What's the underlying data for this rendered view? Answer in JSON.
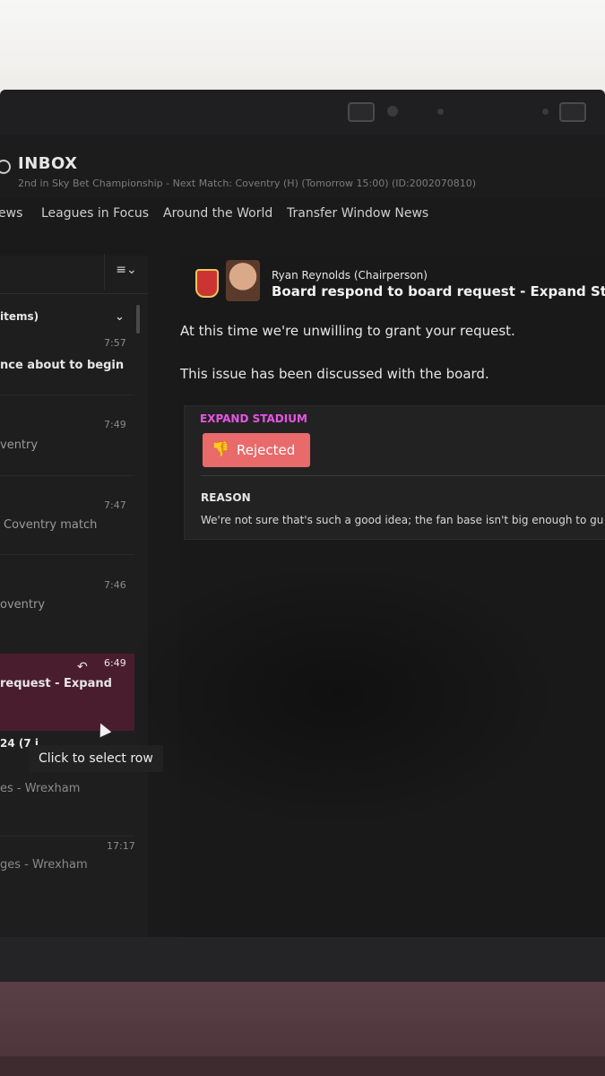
{
  "header": {
    "title": "INBOX",
    "subtitle": "2nd in Sky Bet Championship - Next Match: Coventry (H) (Tomorrow 15:00) (ID:2002070810)"
  },
  "tabs": [
    "ews",
    "Leagues in Focus",
    "Around the World",
    "Transfer Window News"
  ],
  "sidebar": {
    "sort_icon": "≡⌄",
    "group_header": "items)",
    "group_chevron": "⌄",
    "messages": [
      {
        "time": "7:57",
        "subject": "nce about to begin",
        "text": ""
      },
      {
        "time": "7:49",
        "subject": "",
        "text": "ventry"
      },
      {
        "time": "7:47",
        "subject": "",
        "text": "Coventry match"
      },
      {
        "time": "7:46",
        "subject": "",
        "text": "oventry"
      },
      {
        "time": "6:49",
        "subject": "request - Expand",
        "text": ""
      }
    ],
    "group2_header": "24 (7 i",
    "tooltip": "Click to select row",
    "later": [
      {
        "time": "",
        "text": "es - Wrexham"
      },
      {
        "time": "17:17",
        "text": "ges - Wrexham"
      }
    ]
  },
  "detail": {
    "sender_name": "Ryan Reynolds",
    "sender_role": "(Chairperson)",
    "subject": "Board respond to board request - Expand Stadiu",
    "body": [
      "At this time we're unwilling to grant your request.",
      "This issue has been discussed with the board."
    ],
    "card": {
      "title": "EXPAND STADIUM",
      "status": "Rejected",
      "reason_title": "REASON",
      "reason_text": "We're not sure that's such a good idea; the fan base isn't big enough to gu"
    }
  },
  "colors": {
    "accent_pink": "#e655e6",
    "rejected_red": "#e86a6a",
    "selected_row": "#4a1d2e"
  }
}
